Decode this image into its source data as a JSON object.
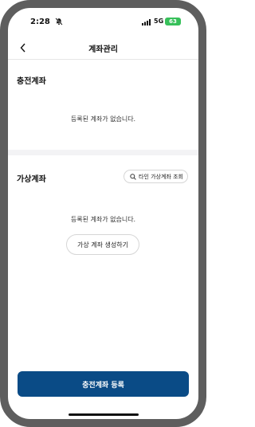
{
  "status_bar": {
    "time": "2:28",
    "network": "5G",
    "battery": "63"
  },
  "header": {
    "title": "계좌관리"
  },
  "charging_section": {
    "title": "충전계좌",
    "empty_message": "등록된 계좌가 없습니다."
  },
  "virtual_section": {
    "title": "가상계좌",
    "search_label": "타인 가상계좌 조회",
    "empty_message": "등록된 계좌가 없습니다.",
    "create_label": "가상 계좌 생성하기"
  },
  "footer": {
    "register_label": "충전계좌 등록"
  },
  "colors": {
    "primary": "#0a4b86",
    "battery": "#37c05a",
    "frame": "#5e5e5e"
  }
}
